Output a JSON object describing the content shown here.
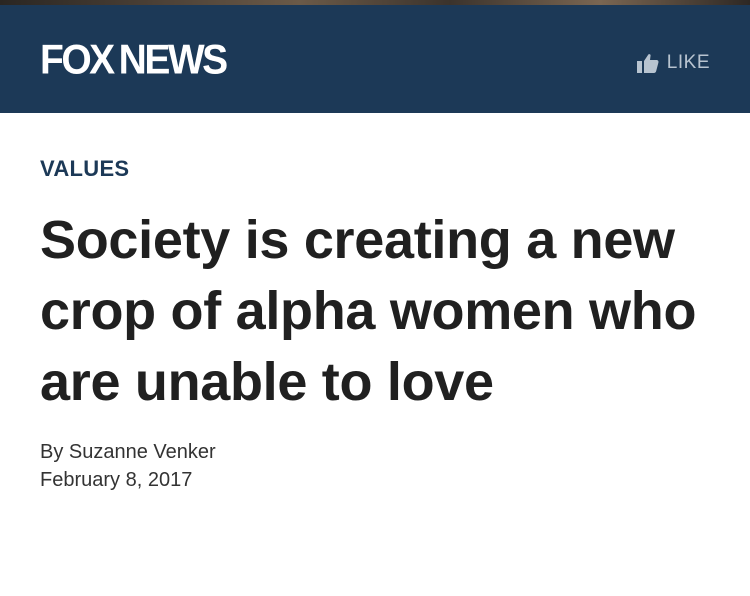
{
  "header": {
    "logo_left": "FOX",
    "logo_right": "NEWS",
    "like_label": "LIKE",
    "icon": "thumbs-up-icon",
    "background_color": "#1c3957"
  },
  "article": {
    "category": "VALUES",
    "headline": "Society is creating a new crop of alpha women who are unable to love",
    "byline": "By Suzanne Venker",
    "date": "February 8, 2017"
  },
  "colors": {
    "brand": "#1c3957",
    "headline": "#202020",
    "like": "#b8c4d0"
  }
}
